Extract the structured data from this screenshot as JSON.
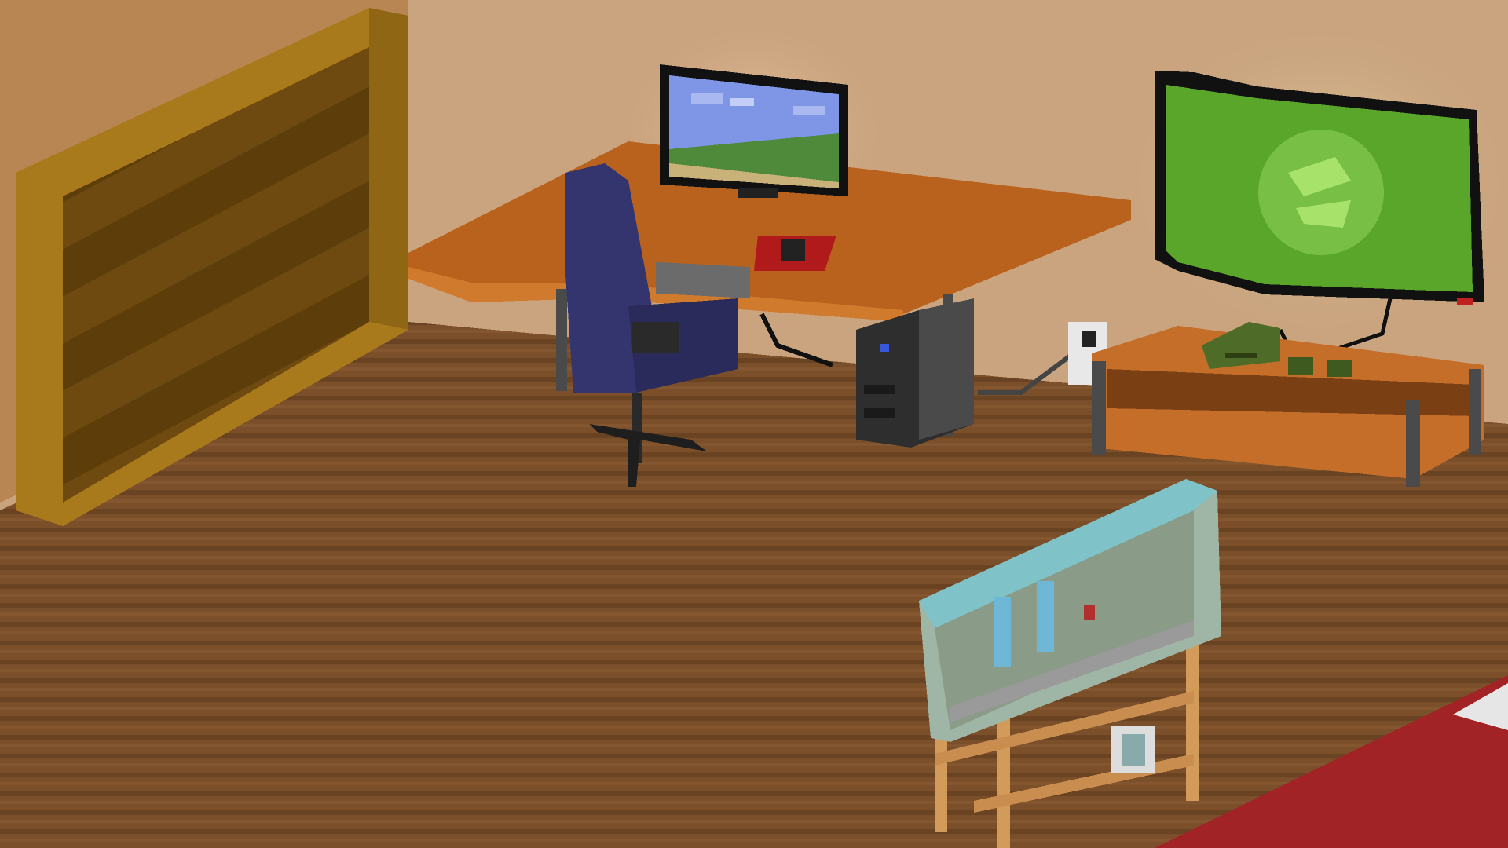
{
  "scene": {
    "description_free": true
  },
  "colors": {
    "wall": "#c9a47f",
    "wall_light": "#d8b48a",
    "floor": "#7a4f2a",
    "floor_dark": "#6a4322",
    "desk_top": "#b8621e",
    "desk_edge": "#d07a2e",
    "bookshelf": "#7a5412",
    "bookshelf_shelf": "#a97a1c",
    "chair": "#34356e",
    "tower": "#2e2e2e",
    "tv_screen": "#5aa62a",
    "tv_logo": "#7ccc46",
    "tv_stand": "#c46e2a",
    "console": "#4f6b28",
    "tank_water": "#7fc3c9",
    "tank_stand": "#d39b5a",
    "rug": "#a22326",
    "monitor_sky": "#7f95e6"
  },
  "icons": [
    "recycle-logo-icon",
    "power-outlet-icon",
    "controller-icon",
    "mug-icon"
  ]
}
